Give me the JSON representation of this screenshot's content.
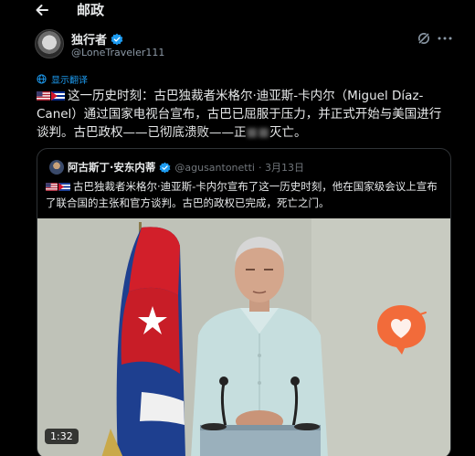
{
  "header": {
    "title": "邮政",
    "back_icon": "arrow-left-icon"
  },
  "author": {
    "display_name": "独行者",
    "handle": "@LoneTraveler111",
    "verified": true
  },
  "actions": {
    "grok_icon": "grok-icon",
    "more_icon": "more-icon"
  },
  "translate_label": "显示翻译",
  "tweet": {
    "text_before_blur": "这一历史时刻：古巴独裁者米格尔·迪亚斯-卡内尔（Miguel Díaz-Canel）通过国家电视台宣布，古巴已屈服于压力，并正式开始与美国进行谈判。古巴政权——已彻底溃败——正",
    "blurred_text": "■■",
    "text_after_blur": "灭亡。"
  },
  "quote": {
    "display_name": "阿古斯丁·安东内蒂",
    "handle": "@agusantonetti",
    "date": "· 3月13日",
    "verified": true,
    "text": "古巴独裁者米格尔·迪亚斯-卡内尔宣布了这一历史时刻，他在国家级会议上宣布了联合国的主张和官方谈判。古巴的政权已完成，死亡之门。",
    "video_duration": "1:32"
  },
  "colors": {
    "accent": "#1d9bf0",
    "background": "#000000",
    "text_primary": "#e7e9ea",
    "text_secondary": "#71767b",
    "heart_bubble": "#f26b3a"
  }
}
